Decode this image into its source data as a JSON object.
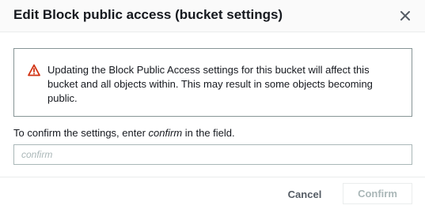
{
  "dialog": {
    "title": "Edit Block public access (bucket settings)",
    "close_icon": "close-icon"
  },
  "alert": {
    "icon": "warning-icon",
    "icon_color": "#d13212",
    "message": "Updating the Block Public Access settings for this bucket will affect this bucket and all objects within. This may result in some objects becoming public."
  },
  "confirm": {
    "label_prefix": "To confirm the settings, enter ",
    "label_keyword": "confirm",
    "label_suffix": " in the field.",
    "input_value": "",
    "input_placeholder": "confirm"
  },
  "footer": {
    "cancel_label": "Cancel",
    "confirm_label": "Confirm"
  }
}
